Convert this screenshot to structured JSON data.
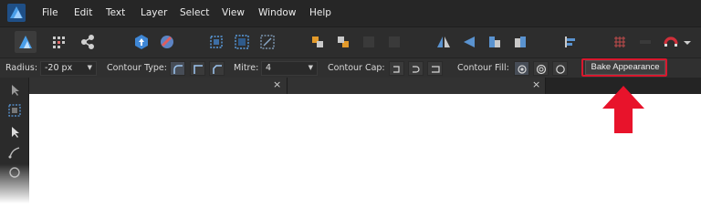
{
  "app": {
    "logo_icon": "affinity-logo-icon",
    "accent_color": "#4a9ee8"
  },
  "menu": {
    "items": [
      {
        "label": "File"
      },
      {
        "label": "Edit"
      },
      {
        "label": "Text"
      },
      {
        "label": "Layer"
      },
      {
        "label": "Select"
      },
      {
        "label": "View"
      },
      {
        "label": "Window"
      },
      {
        "label": "Help"
      }
    ]
  },
  "toolbar": {
    "personas": [
      "designer-persona-icon",
      "pixel-persona-icon",
      "export-persona-icon"
    ],
    "buttons": [
      "placeholder-icon",
      "place-image-icon",
      "selection-box-icon",
      "transform-icon",
      "snap-icon",
      "arrange-back-icon",
      "arrange-forward-icon",
      "group-icon",
      "ungroup-icon",
      "flip-horizontal-icon",
      "flip-vertical-icon",
      "align-left-icon",
      "align-right-icon",
      "distribute-icon",
      "snapping-grid-icon",
      "boolean-icon",
      "magnet-icon"
    ]
  },
  "context": {
    "radius_label": "Radius:",
    "radius_value": "-20 px",
    "contour_type_label": "Contour Type:",
    "mitre_label": "Mitre:",
    "mitre_value": "4",
    "contour_cap_label": "Contour Cap:",
    "contour_fill_label": "Contour Fill:",
    "bake_button": "Bake Appearance",
    "highlight_color": "#d8182e"
  },
  "tabs": [
    {
      "close": "×"
    },
    {
      "close": "×"
    }
  ],
  "annotation": {
    "arrow_color": "#e8132b"
  }
}
